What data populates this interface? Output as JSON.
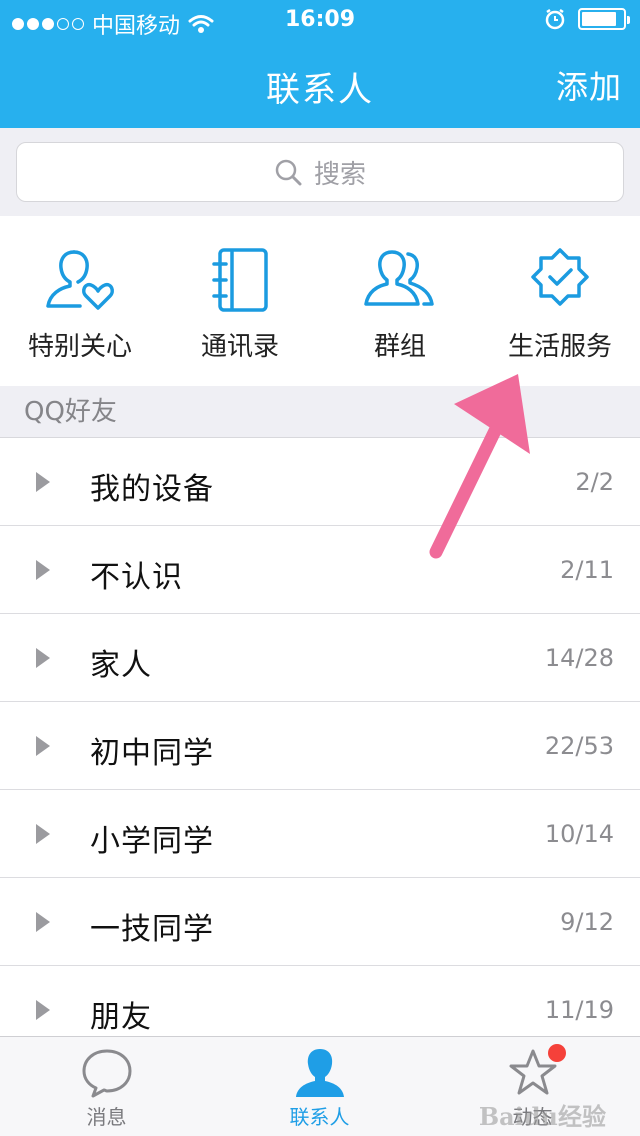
{
  "status_bar": {
    "carrier": "中国移动",
    "time": "16:09",
    "battery_level": 0.85
  },
  "nav": {
    "title": "联系人",
    "add_label": "添加"
  },
  "search": {
    "placeholder": "搜索"
  },
  "quick_entries": [
    {
      "label": "特别关心",
      "icon": "special-care-icon"
    },
    {
      "label": "通讯录",
      "icon": "address-book-icon"
    },
    {
      "label": "群组",
      "icon": "group-icon"
    },
    {
      "label": "生活服务",
      "icon": "life-service-icon"
    }
  ],
  "section": {
    "title": "QQ好友"
  },
  "groups": [
    {
      "name": "我的设备",
      "count": "2/2"
    },
    {
      "name": "不认识",
      "count": "2/11"
    },
    {
      "name": "家人",
      "count": "14/28"
    },
    {
      "name": "初中同学",
      "count": "22/53"
    },
    {
      "name": "小学同学",
      "count": "10/14"
    },
    {
      "name": "一技同学",
      "count": "9/12"
    },
    {
      "name": "朋友",
      "count": "11/19"
    }
  ],
  "tabs": [
    {
      "label": "消息",
      "icon": "message-icon",
      "active": false
    },
    {
      "label": "联系人",
      "icon": "contacts-icon",
      "active": true
    },
    {
      "label": "动态",
      "icon": "star-icon",
      "active": false
    }
  ],
  "colors": {
    "header": "#27b0ee",
    "accent": "#1f9ee6",
    "arrow": "#f06b9a",
    "badge": "#f5413a"
  },
  "watermark": "Baidu经验"
}
